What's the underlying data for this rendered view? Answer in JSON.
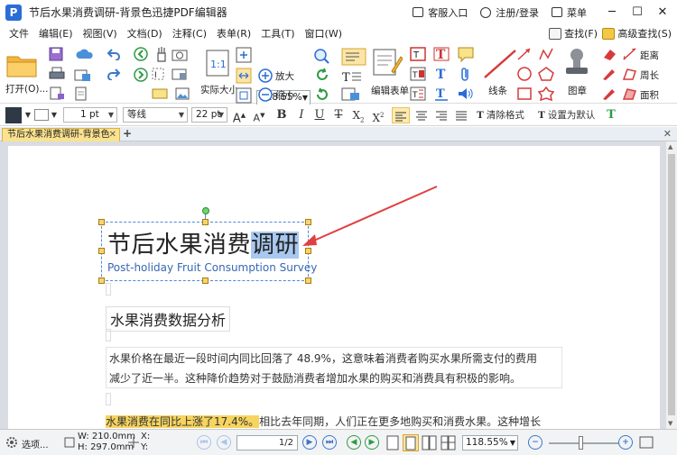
{
  "titlebar": {
    "title": "节后水果消费调研-背景色迅捷PDF编辑器",
    "logo_letter": "P",
    "service": "客服入口",
    "login": "注册/登录",
    "menu": "菜单"
  },
  "menubar": {
    "items": [
      "文件",
      "编辑(E)",
      "视图(V)",
      "文档(D)",
      "注释(C)",
      "表单(R)",
      "工具(T)",
      "窗口(W)"
    ],
    "find": "查找(F)",
    "adv_find": "高级查找(S)"
  },
  "ribbon": {
    "open": "打开(O)...",
    "actual_size": "实际大小",
    "zoom_value": "118.55%",
    "zoom_in": "放大",
    "zoom_out": "缩小",
    "edit_form": "编辑表单",
    "lines": "线条",
    "stamp": "图章",
    "distance": "距离",
    "perimeter": "周长",
    "area": "面积"
  },
  "fmtbar": {
    "line_width": "1 pt",
    "font": "等线",
    "font_size": "22 pt",
    "clear_format": "清除格式",
    "set_default": "设置为默认"
  },
  "tabs": {
    "doc_tab": "节后水果消费调研-背景色"
  },
  "document": {
    "title_plain": "节后水果消费",
    "title_selected": "调研",
    "subtitle": "Post-holiday Fruit Consumption Survey",
    "section_title": "水果消费数据分析",
    "para_line1": "水果价格在最近一段时间内同比回落了  48.9%，这意味着消费者购买水果所需支付的费用",
    "para_line2": "减少了近一半。这种降价趋势对于鼓励消费者增加水果的购买和消费具有积极的影响。",
    "para2_hl1": "水果消费在同比上涨了",
    "para2_hl2": "17.4%。",
    "para2_rest": "相比去年同期，人们正在更多地购买和消费水果。这种增长"
  },
  "statusbar": {
    "options": "选项...",
    "width": "W: 210.0mm",
    "height": "H: 297.0mm",
    "x": "X:",
    "y": "Y:",
    "page": "1",
    "page_total": "/2",
    "zoom": "118.55%"
  }
}
